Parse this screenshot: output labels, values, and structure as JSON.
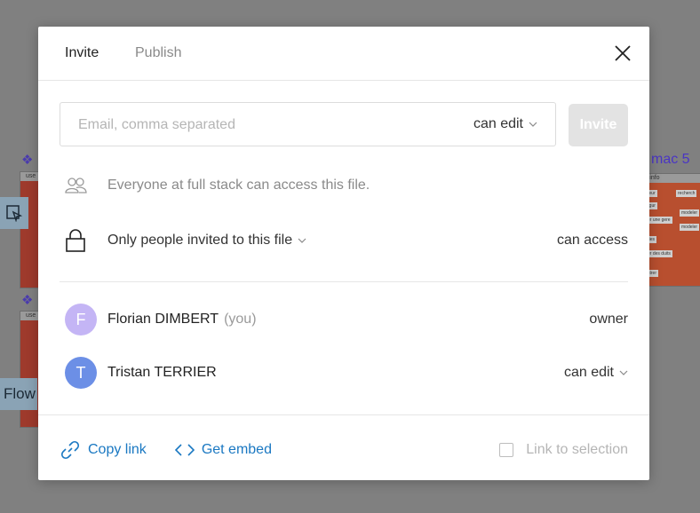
{
  "background": {
    "canvas_label_right": "mac 5",
    "flow_label": "Flow",
    "frame_header_1": "use",
    "frame_header_2": "use",
    "frame_header_3": "r info",
    "mini_items": [
      "teur",
      "rgur",
      "er une gere",
      "ries",
      "er des duits",
      "strer",
      "recherch",
      "modeler",
      "modeler"
    ]
  },
  "tabs": [
    {
      "label": "Invite",
      "active": true
    },
    {
      "label": "Publish",
      "active": false
    }
  ],
  "invite": {
    "email_placeholder": "Email, comma separated",
    "email_value": "",
    "permission": "can edit",
    "button_label": "Invite"
  },
  "access": {
    "team_info": "Everyone at full stack can access this file.",
    "scope_label": "Only people invited to this file",
    "scope_right": "can access"
  },
  "users": [
    {
      "initial": "F",
      "name": "Florian DIMBERT",
      "suffix": "(you)",
      "role": "owner",
      "avatar_color": "#c4b5f5"
    },
    {
      "initial": "T",
      "name": "Tristan TERRIER",
      "suffix": "",
      "role": "can edit",
      "avatar_color": "#6c8fe6"
    }
  ],
  "footer": {
    "copy_link": "Copy link",
    "get_embed": "Get embed",
    "link_to_selection": "Link to selection"
  },
  "icons": {
    "close": "close-icon",
    "team": "team-icon",
    "lock": "lock-icon",
    "chevron": "chevron-down-icon",
    "link": "link-icon",
    "embed": "code-icon"
  },
  "colors": {
    "accent": "#1a78c2",
    "invite_disabled": "#e3e3e3"
  }
}
